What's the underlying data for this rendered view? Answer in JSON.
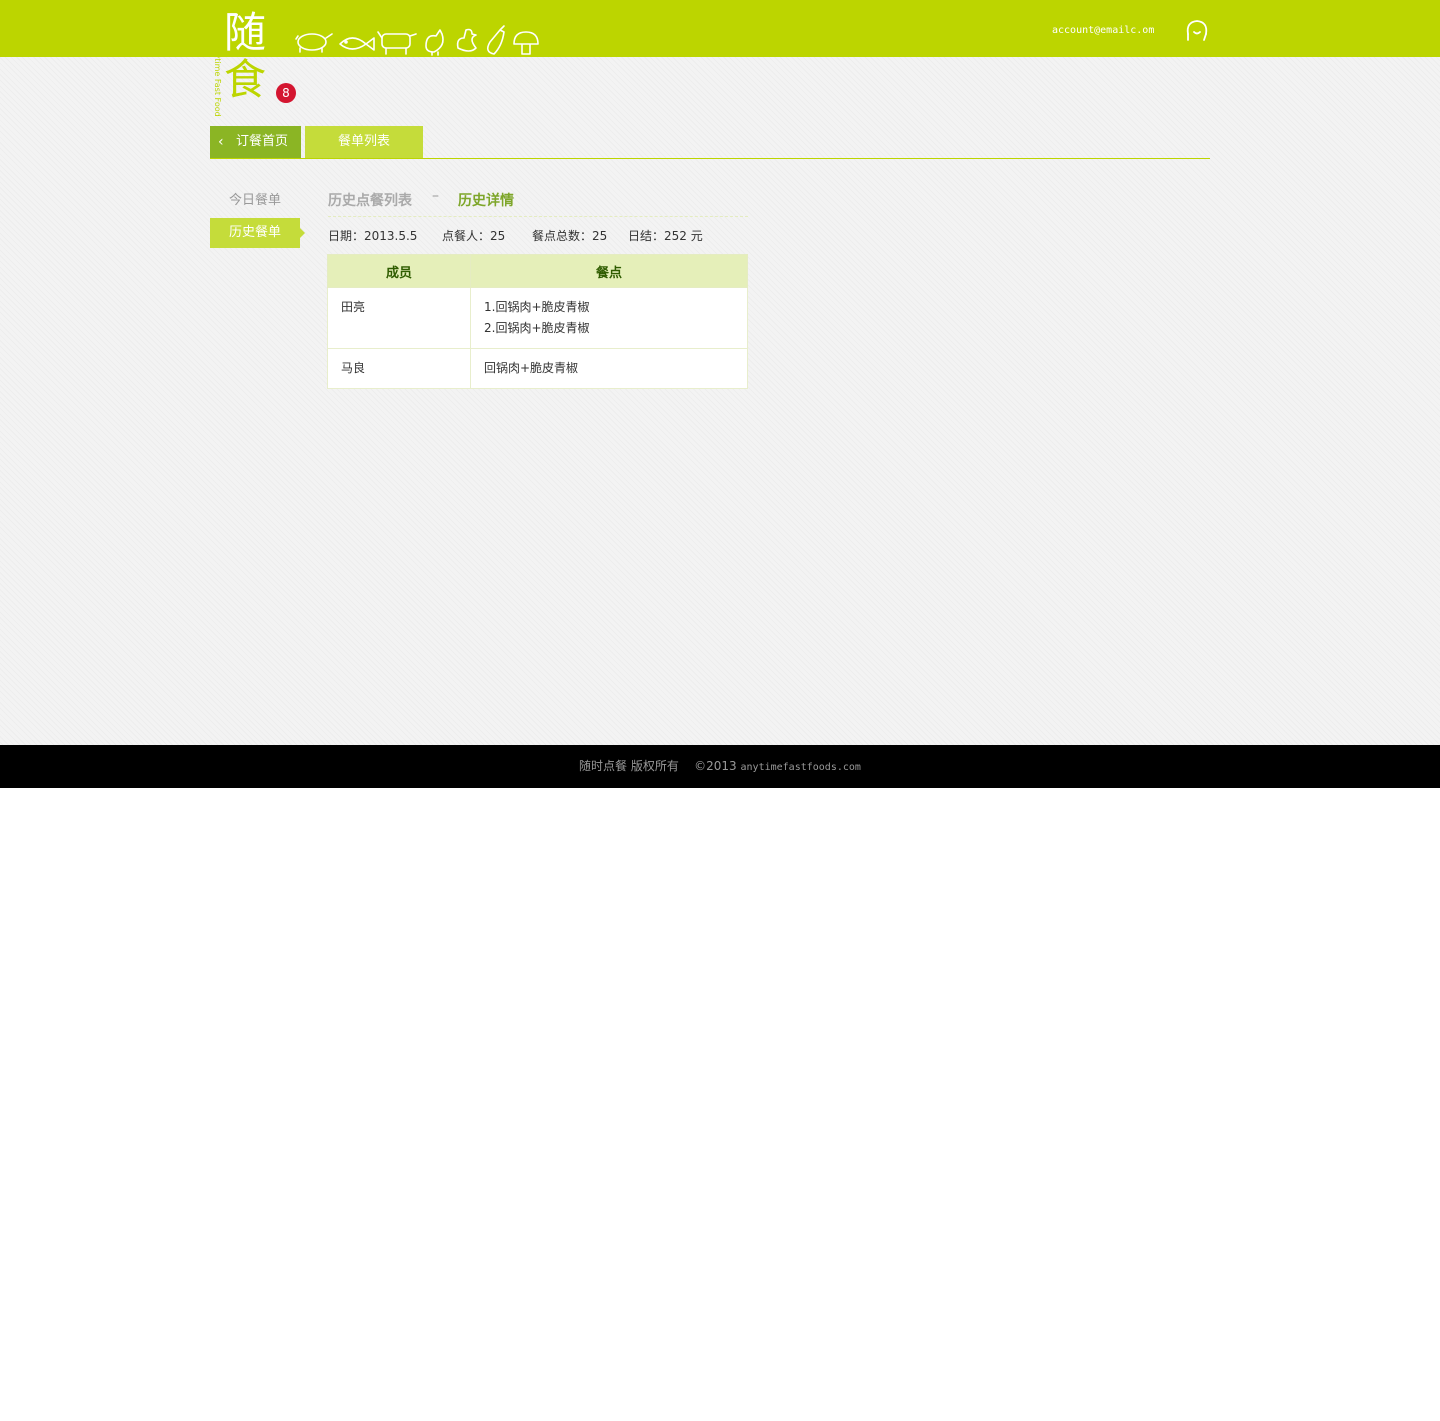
{
  "header": {
    "logo_top": "随",
    "logo_bottom": "食",
    "logo_sub": "Anytime Fast Food",
    "badge": "8",
    "account": "account@emailc.om",
    "icons": [
      "pig-icon",
      "fish-icon",
      "cow-icon",
      "chicken-icon",
      "duck-icon",
      "eggplant-icon",
      "mushroom-icon"
    ],
    "brand_color": "#bcd500"
  },
  "nav": {
    "home_label": "订餐首页",
    "list_label": "餐单列表"
  },
  "sidebar": {
    "items": [
      {
        "label": "今日餐单",
        "active": false
      },
      {
        "label": "历史餐单",
        "active": true
      }
    ]
  },
  "breadcrumb": {
    "parent": "历史点餐列表",
    "separator": "–",
    "current": "历史详情"
  },
  "summary": {
    "date_label": "日期：",
    "date": "2013.5.5",
    "people_label": "点餐人：",
    "people": "25",
    "meals_label": "餐点总数：",
    "meals": "25",
    "total_label": "日结：",
    "total": "252 元"
  },
  "table": {
    "headers": [
      "成员",
      "餐点"
    ],
    "rows": [
      {
        "member": "田亮",
        "meals": [
          "1.回锅肉+脆皮青椒",
          "2.回锅肉+脆皮青椒"
        ]
      },
      {
        "member": "马良",
        "meals": [
          "回锅肉+脆皮青椒"
        ]
      }
    ]
  },
  "footer": {
    "text": "随时点餐 版权所有",
    "copyright": "©2013",
    "domain": "anytimefastfoods.com"
  }
}
